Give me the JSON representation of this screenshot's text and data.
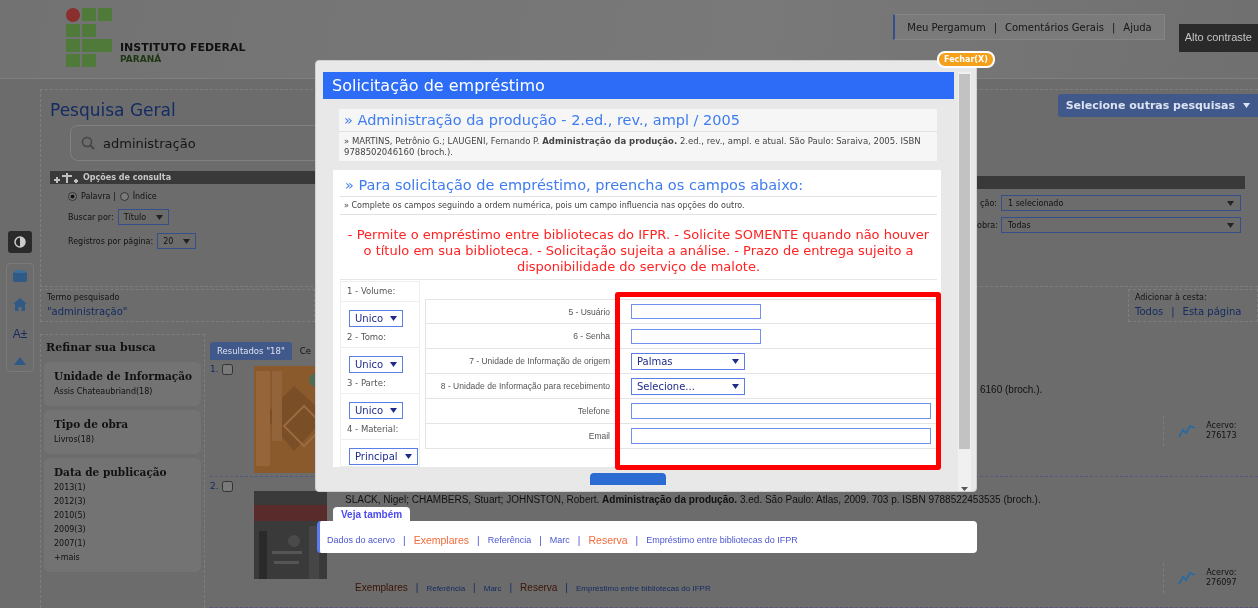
{
  "header": {
    "logo_line1": "INSTITUTO FEDERAL",
    "logo_line2": "PARANÁ",
    "links": [
      "Meu Pergamum",
      "Comentários Gerais",
      "Ajuda"
    ],
    "separator": "|",
    "contrast_button": "Alto contraste"
  },
  "side_rail": [
    {
      "kind": "contrast"
    },
    {
      "kind": "menu"
    },
    {
      "kind": "home"
    },
    {
      "kind": "font-size",
      "label": "A±"
    },
    {
      "kind": "top"
    }
  ],
  "search": {
    "title": "Pesquisa Geral",
    "query": "administração",
    "options_title": "Opções de consulta",
    "modes": [
      {
        "label": "Palavra |",
        "selected": true
      },
      {
        "label": "Índice",
        "selected": false
      }
    ],
    "search_by": {
      "label": "Buscar por:",
      "value": "Título"
    },
    "per_page": {
      "label": "Registros por página:",
      "value": "20"
    },
    "other_searches": "Selecione outras pesquisas",
    "filters": [
      {
        "label": "ção:",
        "value": "1 selecionado"
      },
      {
        "label": "obra:",
        "value": "Todas"
      }
    ]
  },
  "term": {
    "label": "Termo pesquisado",
    "value": "\"administração\""
  },
  "basket": {
    "label": "Adicionar à cesta:",
    "links": [
      "Todos",
      "Esta página"
    ],
    "separator": "|"
  },
  "refine": {
    "title": "Refinar sua busca",
    "groups": [
      {
        "title": "Unidade de Informação",
        "items": [
          "Assis Chateaubriand(18)"
        ]
      },
      {
        "title": "Tipo de obra",
        "items": [
          "Livros(18)"
        ]
      },
      {
        "title": "Data de publicação",
        "items": [
          "2013(1)",
          "2012(3)",
          "2010(5)",
          "2009(3)",
          "2007(1)",
          "+mais"
        ]
      }
    ]
  },
  "results_tabs": [
    {
      "label": "Resultados \"18\"",
      "selected": true
    },
    {
      "label": "Ce",
      "selected": false
    }
  ],
  "results": [
    {
      "number": "1.",
      "checked": false,
      "text": "6160 (broch.).",
      "acervo_label": "Acervo:",
      "acervo": "276173"
    },
    {
      "number": "2.",
      "checked": false,
      "text": "SLACK, Nigel; CHAMBERS, Stuart; JOHNSTON, Robert. **Administração da produção.** 3.ed. São Paulo: Atlas, 2009. 703 p. ISBN 9788522453535 (broch.).",
      "acervo_label": "Acervo:",
      "acervo": "276097",
      "separator": "|",
      "links": [
        {
          "label": "Exemplares",
          "kind": "primary"
        },
        {
          "label": "Referência",
          "kind": "secondary"
        },
        {
          "label": "Marc",
          "kind": "secondary"
        },
        {
          "label": "Reserva",
          "kind": "primary"
        },
        {
          "label": "Empréstimo entre bibliotecas do IFPR",
          "kind": "secondary"
        }
      ]
    }
  ],
  "modal": {
    "close": "Fechar(X)",
    "title": "Solicitação de empréstimo",
    "book_title": "» Administração da produção - 2.ed., rev., ampl / 2005",
    "citation": "» MARTINS, Petrônio G.; LAUGENI, Fernando P. **Administração da produção.** 2.ed., rev., ampl. e atual. São Paulo: Saraiva, 2005. ISBN 9788502046160 (broch.).",
    "form_title": "» Para solicitação de empréstimo, preencha os campos abaixo:",
    "instructions": "» Complete os campos seguindo a ordem numérica, pois um campo influencia nas opções do outro.",
    "warning": "- Permite o empréstimo entre bibliotecas do IFPR. - Solicite SOMENTE quando não houver o título em sua biblioteca. - Solicitação sujeita a análise. - Prazo de entrega sujeito a disponibilidade do serviço de malote.",
    "left_fields": [
      {
        "label": "1 - Volume:",
        "value": "Unico"
      },
      {
        "label": "2 - Tomo:",
        "value": "Unico"
      },
      {
        "label": "3 - Parte:",
        "value": "Unico"
      },
      {
        "label": "4 - Material:",
        "value": "Principal"
      }
    ],
    "right_fields": [
      {
        "label": "5 - Usuário",
        "kind": "text"
      },
      {
        "label": "6 - Senha",
        "kind": "text"
      },
      {
        "label": "7 - Unidade de Informação de origem",
        "kind": "select",
        "value": "Palmas"
      },
      {
        "label": "8 - Unidade de Informação para recebimento",
        "kind": "select",
        "value": "Selecione..."
      },
      {
        "label": "Telefone",
        "kind": "wide"
      },
      {
        "label": "Email",
        "kind": "wide"
      }
    ],
    "fields_highlighted": true
  },
  "see_also": {
    "title": "Veja também",
    "separator": "|",
    "links": [
      {
        "label": "Dados do acervo",
        "kind": "secondary"
      },
      {
        "label": "Exemplares",
        "kind": "primary"
      },
      {
        "label": "Referência",
        "kind": "secondary"
      },
      {
        "label": "Marc",
        "kind": "secondary"
      },
      {
        "label": "Reserva",
        "kind": "primary"
      },
      {
        "label": "Empréstimo entre bibliotecas do IFPR",
        "kind": "secondary"
      }
    ]
  }
}
